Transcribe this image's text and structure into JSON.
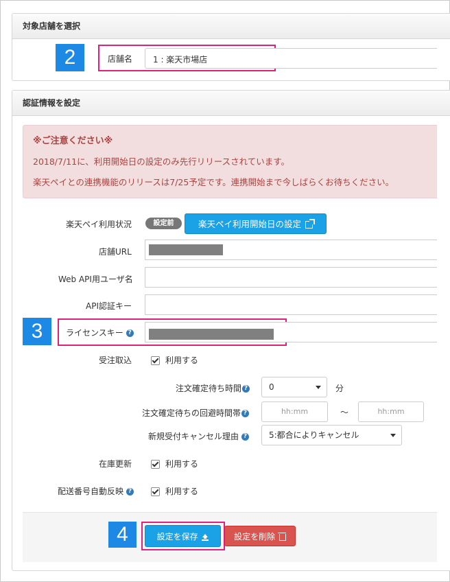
{
  "store_panel": {
    "title": "対象店舗を選択",
    "label": "店舗名",
    "value": "1 : 楽天市場店",
    "step": "2"
  },
  "auth_panel": {
    "title": "認証情報を設定",
    "notice": {
      "title": "※ご注意ください※",
      "line1": "2018/7/11に、利用開始日の設定のみ先行リリースされています。",
      "line2": "楽天ペイとの連携機能のリリースは7/25予定です。連携開始まで今しばらくお待ちください。"
    },
    "rakuten_pay_status": {
      "label": "楽天ペイ利用状況",
      "badge": "設定前",
      "button": "楽天ペイ利用開始日の設定"
    },
    "store_url": {
      "label": "店舗URL"
    },
    "api_user": {
      "label": "Web API用ユーザ名"
    },
    "api_key": {
      "label": "API認証キー"
    },
    "license_key": {
      "label": "ライセンスキー",
      "step": "3"
    },
    "order_import": {
      "label": "受注取込",
      "checkbox": "利用する"
    },
    "wait_time": {
      "label": "注文確定待ち時間",
      "value": "0",
      "unit": "分"
    },
    "avoid_time": {
      "label": "注文確定待ちの回避時間帯",
      "from_placeholder": "hh:mm",
      "tilde": "〜",
      "to_placeholder": "hh:mm"
    },
    "cancel_reason": {
      "label": "新規受付キャンセル理由",
      "value": "5:都合によりキャンセル"
    },
    "stock_update": {
      "label": "在庫更新",
      "checkbox": "利用する"
    },
    "shipping_number": {
      "label": "配送番号自動反映",
      "checkbox": "利用する"
    },
    "footer": {
      "step": "4",
      "save": "設定を保存",
      "delete": "設定を削除"
    }
  },
  "colors": {
    "accent": "#1e88e5",
    "highlight": "#e0207a",
    "danger": "#d9534f",
    "notice_bg": "#f2dede"
  }
}
